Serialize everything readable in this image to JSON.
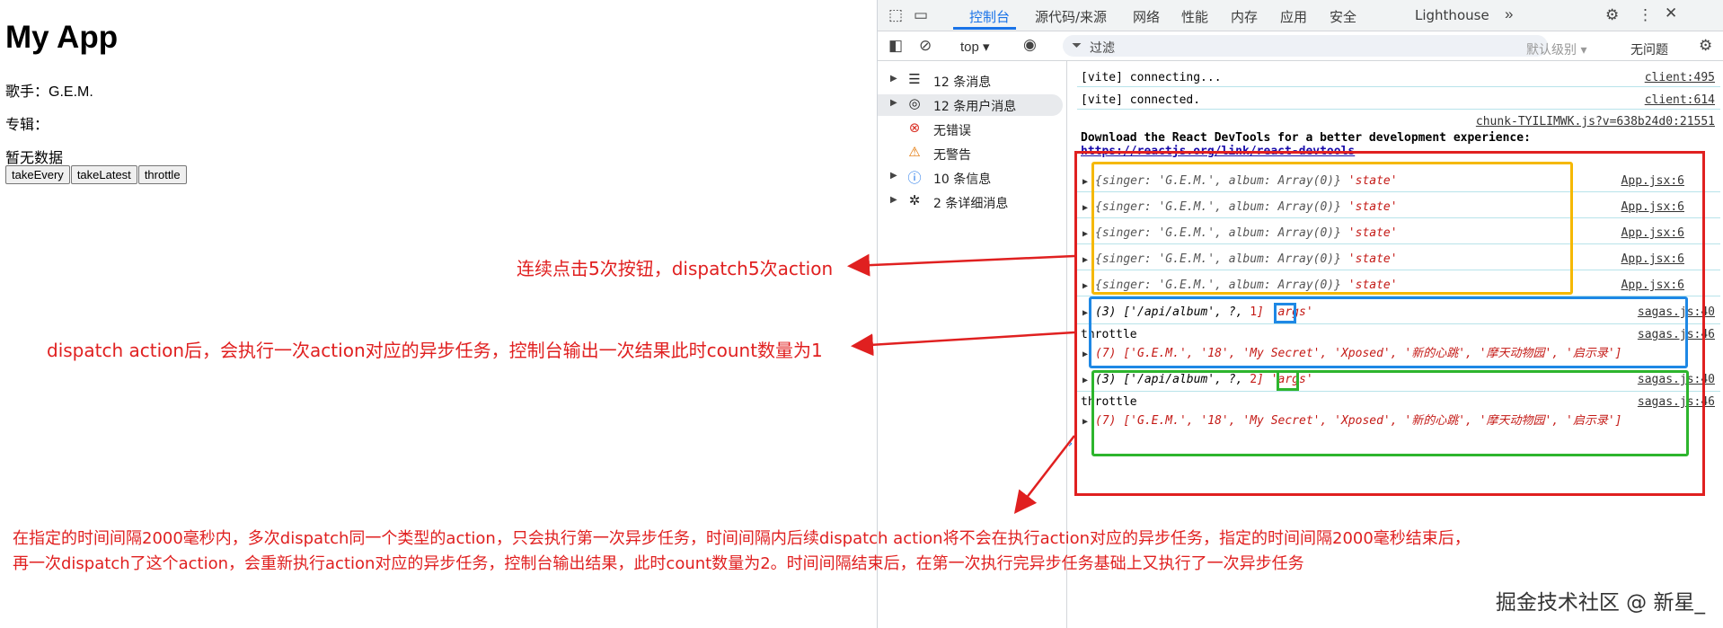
{
  "app": {
    "title": "My App",
    "singer": "歌手：G.E.M.",
    "album": "专辑：",
    "empty": "暂无数据",
    "buttons": [
      "takeEvery",
      "takeLatest",
      "throttle"
    ]
  },
  "devtools": {
    "tabs": [
      "控制台",
      "源代码/来源",
      "网络",
      "性能",
      "内存",
      "应用",
      "安全",
      "Lighthouse"
    ],
    "context": "top ▾",
    "filter_placeholder": "过滤",
    "levels": "默认级别 ▾",
    "issues": "无问题",
    "sidebar": [
      {
        "label": "12 条消息",
        "icon": "list-icon",
        "expandable": true
      },
      {
        "label": "12 条用户消息",
        "icon": "user-icon",
        "expandable": true
      },
      {
        "label": "无错误",
        "icon": "error-icon",
        "expandable": false
      },
      {
        "label": "无警告",
        "icon": "warning-icon",
        "expandable": false
      },
      {
        "label": "10 条信息",
        "icon": "info-icon",
        "expandable": true
      },
      {
        "label": "2 条详细消息",
        "icon": "bug-icon",
        "expandable": true
      }
    ],
    "console": {
      "vite_connecting": "[vite] connecting...",
      "vite_connecting_src": "client:495",
      "vite_connected": "[vite] connected.",
      "vite_connected_src": "client:614",
      "chunk_src": "chunk-TYILIMWK.js?v=638b24d0:21551",
      "react_msg": "Download the React DevTools for a better experience:",
      "react_msg_full": "Download the React DevTools for a better development experience:",
      "react_link": "https://reactjs.org/link/react-devtools",
      "state_logs": [
        {
          "obj": "{singer: 'G.E.M.', album: Array(0)}",
          "tag": "'state'",
          "src": "App.jsx:6"
        },
        {
          "obj": "{singer: 'G.E.M.', album: Array(0)}",
          "tag": "'state'",
          "src": "App.jsx:6"
        },
        {
          "obj": "{singer: 'G.E.M.', album: Array(0)}",
          "tag": "'state'",
          "src": "App.jsx:6"
        },
        {
          "obj": "{singer: 'G.E.M.', album: Array(0)}",
          "tag": "'state'",
          "src": "App.jsx:6"
        },
        {
          "obj": "{singer: 'G.E.M.', album: Array(0)}",
          "tag": "'state'",
          "src": "App.jsx:6"
        }
      ],
      "args1": {
        "prefix": "(3) ['/api/album', ?, ",
        "count": "1",
        "suffix": "] 'args'",
        "src": "sagas.js:40"
      },
      "throttle1": {
        "label": "throttle",
        "src": "sagas.js:46"
      },
      "albums1": "(7) ['G.E.M.', '18', 'My Secret', 'Xposed', '新的心跳', '摩天动物园', '启示录']",
      "args2": {
        "prefix": "(3) ['/api/album', ?, ",
        "count": "2",
        "suffix": "] 'args'",
        "src": "sagas.js:40"
      },
      "throttle2": {
        "label": "throttle",
        "src": "sagas.js:46"
      },
      "albums2": "(7) ['G.E.M.', '18', 'My Secret', 'Xposed', '新的心跳', '摩天动物园', '启示录']"
    }
  },
  "annotations": {
    "a1": "连续点击5次按钮，dispatch5次action",
    "a2": "dispatch action后，会执行一次action对应的异步任务，控制台输出一次结果此时count数量为1",
    "a3_line1": "在指定的时间间隔2000毫秒内，多次dispatch同一个类型的action，只会执行第一次异步任务，时间间隔内后续dispatch action将不会在执行action对应的异步任务，指定的时间间隔2000毫秒结束后，",
    "a3_line2": "再一次dispatch了这个action，会重新执行action对应的异步任务，控制台输出结果，此时count数量为2。时间间隔结束后，在第一次执行完异步任务基础上又执行了一次异步任务"
  },
  "watermark": "掘金技术社区 @ 新星_",
  "colors": {
    "accent": "#1a73e8",
    "annotation": "#e02020",
    "yellow": "#f5b800",
    "blue": "#1e88e5",
    "green": "#2db52d"
  }
}
